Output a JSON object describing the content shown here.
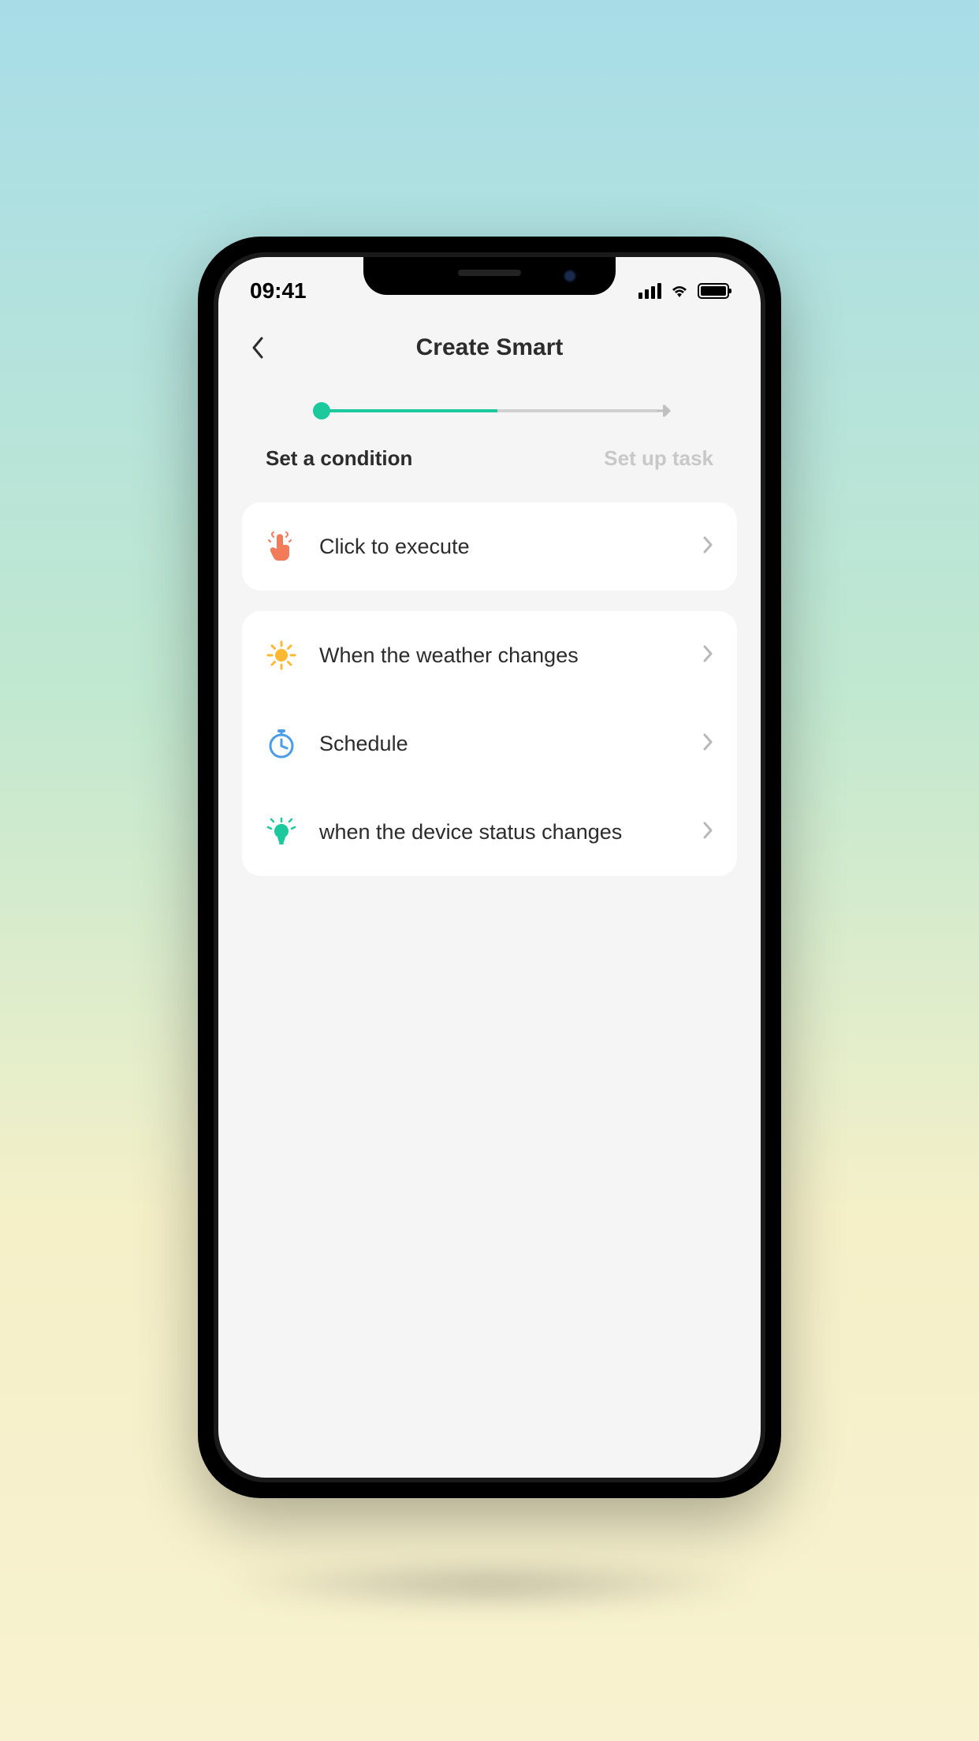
{
  "statusBar": {
    "time": "09:41"
  },
  "header": {
    "title": "Create Smart"
  },
  "progress": {
    "step1": "Set a condition",
    "step2": "Set up task"
  },
  "conditions": {
    "execute": "Click to execute",
    "weather": "When the weather changes",
    "schedule": "Schedule",
    "device": "when the device status changes"
  },
  "colors": {
    "accent": "#1cc99c",
    "tapIcon": "#f27b5a",
    "weatherIcon": "#ffb830",
    "scheduleIcon": "#4a9de8",
    "deviceIcon": "#1cc99c"
  }
}
